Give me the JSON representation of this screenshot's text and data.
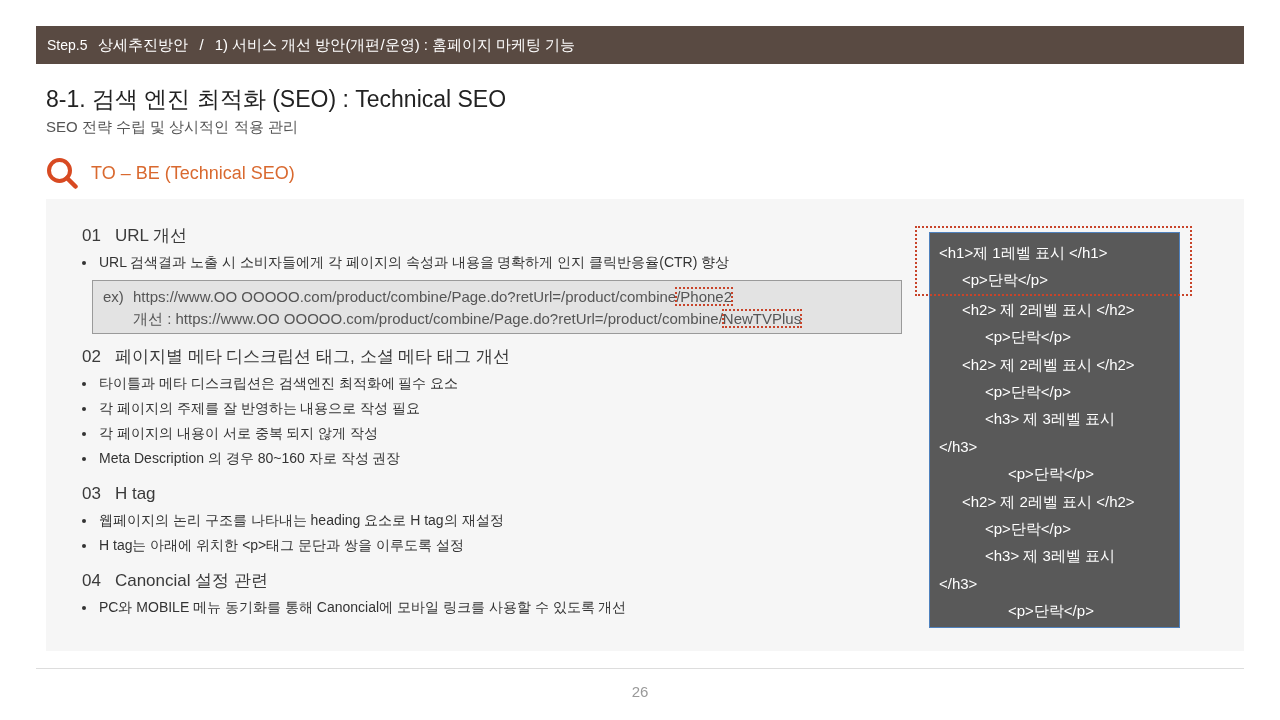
{
  "header": {
    "breadcrumb": [
      "Step.5",
      "상세추진방안",
      "/",
      "1) 서비스 개선 방안(개편/운영) : 홈페이지 마케팅 기능"
    ]
  },
  "title": "8-1. 검색 엔진 최적화 (SEO) : Technical SEO",
  "subtitle": "SEO 전략 수립 및 상시적인 적용 관리",
  "section": {
    "heading": "TO – BE (Technical SEO)"
  },
  "items": [
    {
      "number": "01",
      "title": "URL 개선",
      "bullets": [
        "URL 검색결과 노출 시 소비자들에게 각 페이지의 속성과 내용을 명확하게 인지 클릭반응율(CTR) 향상"
      ],
      "example": {
        "lines": [
          {
            "prefix": "ex)",
            "text": "https://www.OO OOOOO.com/product/combine/Page.do?retUrl=/product/combine",
            "highlight": "/Phone2"
          },
          {
            "text": "개선 : https://www.OO OOOOO.com/product/combine/Page.do?retUrl=/product/combine/",
            "highlight": "NewTVPlus"
          }
        ]
      }
    },
    {
      "number": "02",
      "title": "페이지별 메타 디스크립션 태그, 소셜 메타 태그 개선",
      "bullets": [
        "타이틀과 메타 디스크립션은 검색엔진 최적화에 필수 요소",
        "각 페이지의 주제를 잘 반영하는 내용으로 작성 필요",
        "각 페이지의 내용이 서로 중복 되지 않게 작성",
        "Meta Description 의 경우 80~160 자로 작성 권장"
      ]
    },
    {
      "number": "03",
      "title": "H tag",
      "bullets": [
        "웹페이지의 논리 구조를 나타내는 heading 요소로 H tag의 재설정",
        "H tag는 아래에 위치한 <p>태그 문단과 쌍을 이루도록 설정"
      ]
    },
    {
      "number": "04",
      "title": "Canoncial 설정 관련",
      "bullets": [
        "PC와 MOBILE 메뉴 동기화를 통해 Canoncial에 모바일 링크를 사용할 수 있도록 개선"
      ]
    }
  ],
  "code_sample": {
    "lines": [
      {
        "text": "<h1>제 1레벨 표시 </h1>",
        "highlighted": true,
        "children": [
          {
            "text": "<p>단락</p>",
            "highlighted": true
          },
          {
            "text": "<h2> 제 2레벨 표시 </h2>",
            "highlighted": false,
            "children": [
              {
                "text": "<p>단락</p>",
                "highlighted": false
              }
            ]
          },
          {
            "text": "<h2> 제 2레벨 표시 </h2>",
            "highlighted": false,
            "children": [
              {
                "text": "<p>단락</p>",
                "highlighted": false
              },
              {
                "text": "<h3> 제 3레벨 표시 </h3>",
                "highlighted": false,
                "children": [
                  {
                    "text": "<p>단락</p>",
                    "highlighted": false
                  }
                ]
              }
            ]
          },
          {
            "text": "<h2> 제 2레벨 표시 </h2>",
            "highlighted": false,
            "children": [
              {
                "text": "<p>단락</p>",
                "highlighted": false
              },
              {
                "text": "<h3> 제 3레벨 표시 </h3>",
                "highlighted": false,
                "children": [
                  {
                    "text": "<p>단락</p>",
                    "highlighted": false
                  }
                ]
              }
            ]
          }
        ]
      }
    ]
  },
  "page_number": "26"
}
